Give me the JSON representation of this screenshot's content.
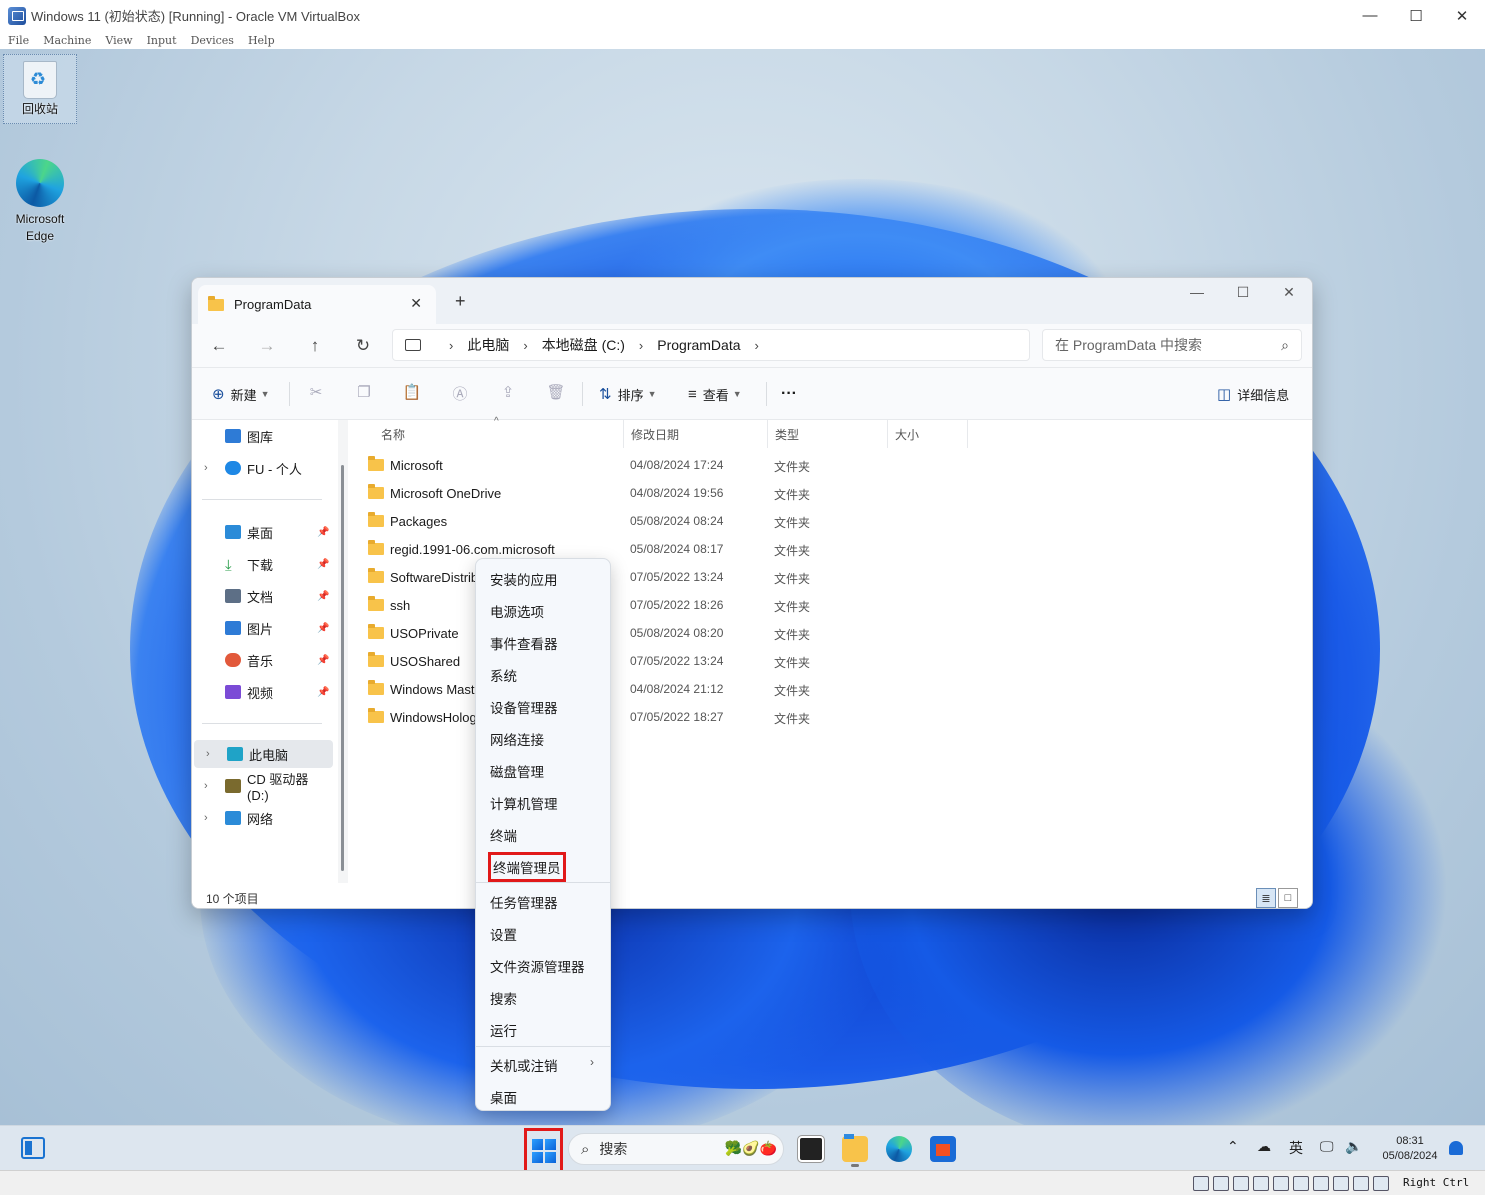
{
  "vbox": {
    "title": "Windows 11 (初始状态) [Running] - Oracle VM VirtualBox",
    "menu": [
      "File",
      "Machine",
      "View",
      "Input",
      "Devices",
      "Help"
    ],
    "host_key": "Right Ctrl"
  },
  "desktop": {
    "icons": [
      {
        "label": "回收站",
        "icon": "recycle-bin-icon"
      },
      {
        "label": "Microsoft Edge",
        "icon": "edge-icon"
      }
    ]
  },
  "explorer": {
    "tab_title": "ProgramData",
    "breadcrumbs": [
      "此电脑",
      "本地磁盘 (C:)",
      "ProgramData"
    ],
    "search_placeholder": "在 ProgramData 中搜索",
    "toolbar": {
      "new_label": "新建",
      "sort_label": "排序",
      "view_label": "查看",
      "more_label": "···",
      "details_label": "详细信息"
    },
    "nav": [
      {
        "label": "图库",
        "color": "#2e7bd6"
      },
      {
        "label": "FU - 个人",
        "color": "#1e88e5",
        "expand": true
      },
      {
        "label": "桌面",
        "color": "#2b8bd8",
        "pinned": true
      },
      {
        "label": "下载",
        "color": "#2a9d4a",
        "pinned": true
      },
      {
        "label": "文档",
        "color": "#5d6f86",
        "pinned": true
      },
      {
        "label": "图片",
        "color": "#2e7bd6",
        "pinned": true
      },
      {
        "label": "音乐",
        "color": "#e2593b",
        "pinned": true
      },
      {
        "label": "视频",
        "color": "#7b4bd6",
        "pinned": true
      },
      {
        "label": "此电脑",
        "color": "#1fa3c7",
        "expand": true,
        "selected": true
      },
      {
        "label": "CD 驱动器 (D:)",
        "color": "#7a6a2e",
        "expand": true
      },
      {
        "label": "网络",
        "color": "#2b8bd8",
        "expand": true
      }
    ],
    "columns": {
      "name": "名称",
      "date": "修改日期",
      "type": "类型",
      "size": "大小"
    },
    "rows": [
      {
        "name": "Microsoft",
        "date": "04/08/2024 17:24",
        "type": "文件夹"
      },
      {
        "name": "Microsoft OneDrive",
        "date": "04/08/2024 19:56",
        "type": "文件夹"
      },
      {
        "name": "Packages",
        "date": "05/08/2024 08:24",
        "type": "文件夹"
      },
      {
        "name": "regid.1991-06.com.microsoft",
        "date": "05/08/2024 08:17",
        "type": "文件夹"
      },
      {
        "name": "SoftwareDistrib",
        "date": "07/05/2022 13:24",
        "type": "文件夹"
      },
      {
        "name": "ssh",
        "date": "07/05/2022 18:26",
        "type": "文件夹"
      },
      {
        "name": "USOPrivate",
        "date": "05/08/2024 08:20",
        "type": "文件夹"
      },
      {
        "name": "USOShared",
        "date": "07/05/2022 13:24",
        "type": "文件夹"
      },
      {
        "name": "Windows Mast",
        "date": "04/08/2024 21:12",
        "type": "文件夹"
      },
      {
        "name": "WindowsHolog",
        "date": "07/05/2022 18:27",
        "type": "文件夹"
      }
    ],
    "status": "10 个项目"
  },
  "context_menu": {
    "group1": [
      "安装的应用",
      "电源选项",
      "事件查看器",
      "系统",
      "设备管理器",
      "网络连接",
      "磁盘管理",
      "计算机管理",
      "终端",
      "终端管理员"
    ],
    "group2": [
      "任务管理器",
      "设置",
      "文件资源管理器",
      "搜索",
      "运行"
    ],
    "group3": [
      "关机或注销",
      "桌面"
    ],
    "highlighted": "终端管理员"
  },
  "taskbar": {
    "search_label": "搜索",
    "ime": "英",
    "time": "08:31",
    "date": "05/08/2024"
  }
}
